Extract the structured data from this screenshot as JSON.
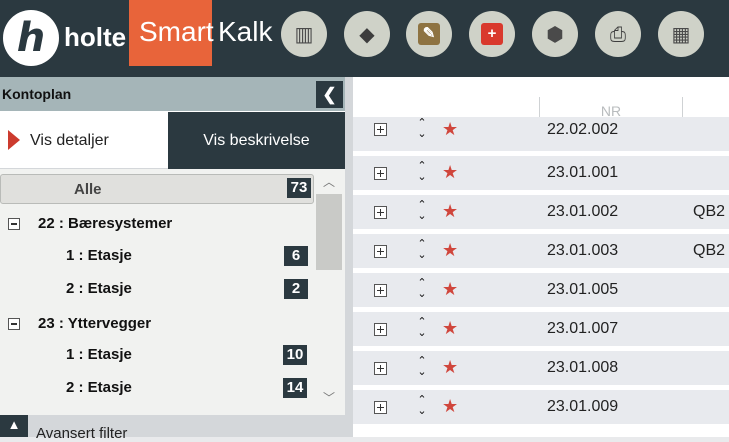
{
  "brand": {
    "logo_letter": "h",
    "company": "holte",
    "product_part1": "Smart",
    "product_part2": "Kalk",
    "accent_color": "#e8643a",
    "dark_color": "#2b3940"
  },
  "toolbar": {
    "tools": [
      {
        "icon": "library-books-icon",
        "glyph": "▥"
      },
      {
        "icon": "graduation-cap-icon",
        "glyph": "◆"
      },
      {
        "icon": "edit-pencil-icon",
        "glyph": "✎"
      },
      {
        "icon": "add-plus-icon",
        "glyph": "+"
      },
      {
        "icon": "cubes-icon",
        "glyph": "⬢"
      },
      {
        "icon": "printer-icon",
        "glyph": "⎙"
      },
      {
        "icon": "calendar-icon",
        "glyph": "▦"
      }
    ]
  },
  "left_panel": {
    "title": "Kontoplan",
    "collapse_glyph": "❮",
    "tab_details": "Vis detaljer",
    "tab_description": "Vis beskrivelse",
    "all_label": "Alle",
    "all_count": "73",
    "groups": [
      {
        "label": "22 : Bæresystemer",
        "children": [
          {
            "label": "1 : Etasje",
            "count": "6"
          },
          {
            "label": "2 : Etasje",
            "count": "2"
          }
        ]
      },
      {
        "label": "23 : Yttervegger",
        "children": [
          {
            "label": "1 : Etasje",
            "count": "10"
          },
          {
            "label": "2 : Etasje",
            "count": "14"
          }
        ]
      }
    ],
    "advanced_filter": "Avansert filter",
    "advanced_glyph": "▲"
  },
  "grid": {
    "nr_header": "NR",
    "rows": [
      {
        "nr": "22.02.002",
        "code": ""
      },
      {
        "nr": "23.01.001",
        "code": ""
      },
      {
        "nr": "23.01.002",
        "code": "QB2"
      },
      {
        "nr": "23.01.003",
        "code": "QB2"
      },
      {
        "nr": "23.01.005",
        "code": ""
      },
      {
        "nr": "23.01.007",
        "code": ""
      },
      {
        "nr": "23.01.008",
        "code": ""
      },
      {
        "nr": "23.01.009",
        "code": ""
      }
    ]
  }
}
